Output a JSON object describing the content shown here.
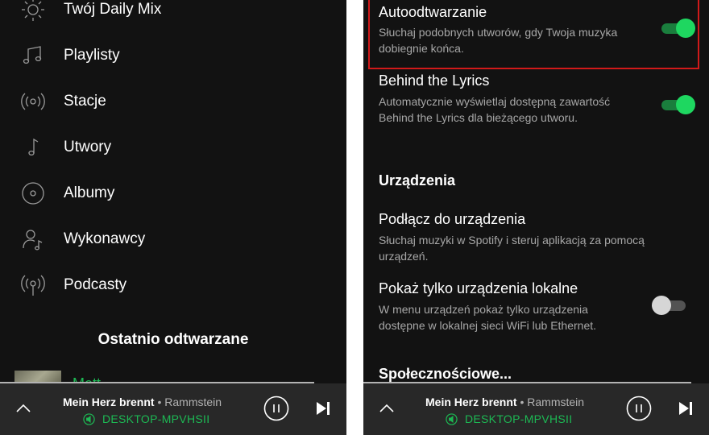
{
  "library": {
    "items": [
      {
        "label": "Twój Daily Mix",
        "icon": "sun-icon"
      },
      {
        "label": "Playlisty",
        "icon": "music-notes-icon"
      },
      {
        "label": "Stacje",
        "icon": "radio-icon"
      },
      {
        "label": "Utwory",
        "icon": "music-note-icon"
      },
      {
        "label": "Albumy",
        "icon": "album-icon"
      },
      {
        "label": "Wykonawcy",
        "icon": "artist-icon"
      },
      {
        "label": "Podcasty",
        "icon": "podcast-icon"
      }
    ],
    "recent_title": "Ostatnio odtwarzane",
    "recent_item_label": "Mett"
  },
  "settings": {
    "autoplay": {
      "title": "Autoodtwarzanie",
      "description": "Słuchaj podobnych utworów, gdy Twoja muzyka dobiegnie końca.",
      "enabled": true
    },
    "behind_lyrics": {
      "title": "Behind the Lyrics",
      "description": "Automatycznie wyświetlaj dostępną zawartość Behind the Lyrics dla bieżącego utworu.",
      "enabled": true
    },
    "devices_heading": "Urządzenia",
    "connect_device": {
      "title": "Podłącz do urządzenia",
      "description": "Słuchaj muzyki w Spotify i steruj aplikacją za pomocą urządzeń."
    },
    "local_devices": {
      "title": "Pokaż tylko urządzenia lokalne",
      "description": "W menu urządzeń pokaż tylko urządzenia dostępne w lokalnej sieci WiFi lub Ethernet.",
      "enabled": false
    },
    "social_heading": "Społecznościowe..."
  },
  "player": {
    "song": "Mein Herz brennt",
    "separator": " • ",
    "artist": "Rammstein",
    "device": "DESKTOP-MPVHSII"
  },
  "colors": {
    "background": "#121212",
    "player_background": "#282828",
    "accent_green": "#1db954",
    "highlight_red": "#d11a1a"
  }
}
